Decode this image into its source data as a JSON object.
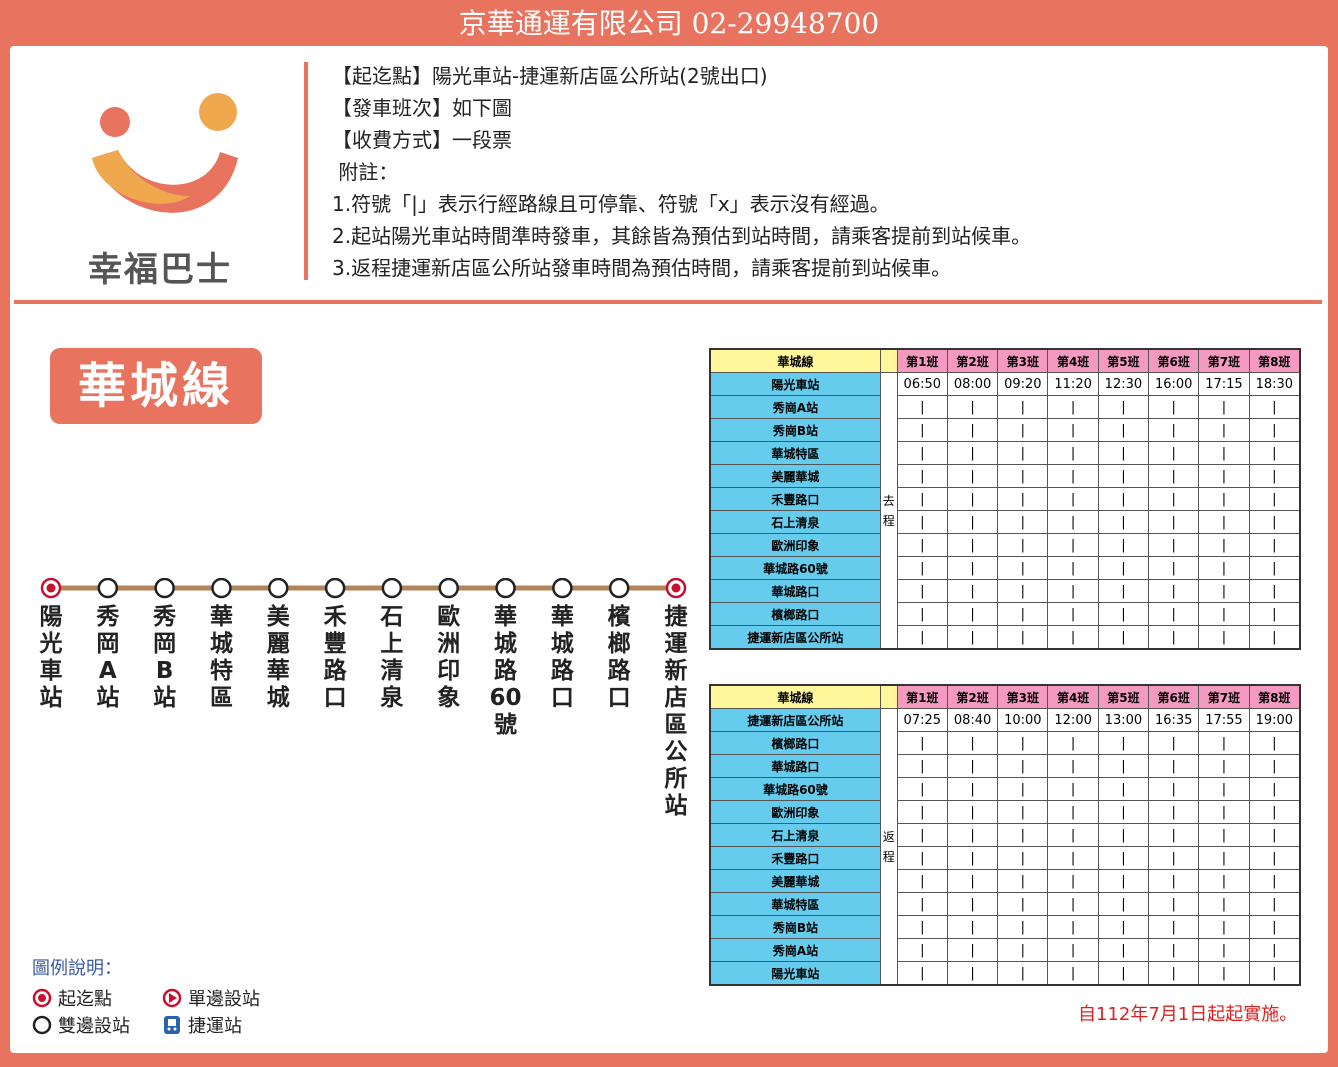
{
  "header": {
    "title": "京華通運有限公司 02-29948700"
  },
  "logo": {
    "text": "幸福巴士",
    "icon": "happy-bus-logo-icon"
  },
  "info_lines": [
    "【起迄點】陽光車站-捷運新店區公所站(2號出口)",
    "【發車班次】如下圖",
    "【收費方式】一段票",
    " 附註：",
    "1.符號「|」表示行經路線且可停靠、符號「x」表示沒有經過。",
    "2.起站陽光車站時間準時發車，其餘皆為預估到站時間，請乘客提前到站候車。",
    "3.返程捷運新店區公所站發車時間為預估時間，請乘客提前到站候車。"
  ],
  "route_name": "華城線",
  "stations": [
    {
      "label": "陽光車站",
      "type": "terminal"
    },
    {
      "label": "秀岡A站",
      "type": "both"
    },
    {
      "label": "秀岡B站",
      "type": "both"
    },
    {
      "label": "華城特區",
      "type": "both"
    },
    {
      "label": "美麗華城",
      "type": "both"
    },
    {
      "label": "禾豐路口",
      "type": "both"
    },
    {
      "label": "石上清泉",
      "type": "both"
    },
    {
      "label": "歐洲印象",
      "type": "both"
    },
    {
      "label": "華城路60號",
      "type": "both"
    },
    {
      "label": "華城路口",
      "type": "both"
    },
    {
      "label": "檳榔路口",
      "type": "both"
    },
    {
      "label": "捷運新店區公所站",
      "type": "terminal"
    }
  ],
  "legend": {
    "title": "圖例說明：",
    "terminal": "起迄點",
    "one_side": "單邊設站",
    "both_sides": "雙邊設站",
    "mrt": "捷運站"
  },
  "outbound": {
    "route": "華城線",
    "direction": "去程",
    "runs": [
      "第1班",
      "第2班",
      "第3班",
      "第4班",
      "第5班",
      "第6班",
      "第7班",
      "第8班"
    ],
    "stops": [
      "陽光車站",
      "秀崗A站",
      "秀崗B站",
      "華城特區",
      "美麗華城",
      "禾豐路口",
      "石上清泉",
      "歐洲印象",
      "華城路60號",
      "華城路口",
      "檳榔路口",
      "捷運新店區公所站"
    ],
    "first_times": [
      "06:50",
      "08:00",
      "09:20",
      "11:20",
      "12:30",
      "16:00",
      "17:15",
      "18:30"
    ],
    "pass_mark": "|"
  },
  "inbound": {
    "route": "華城線",
    "direction": "返程",
    "runs": [
      "第1班",
      "第2班",
      "第3班",
      "第4班",
      "第5班",
      "第6班",
      "第7班",
      "第8班"
    ],
    "stops": [
      "捷運新店區公所站",
      "檳榔路口",
      "華城路口",
      "華城路60號",
      "歐洲印象",
      "石上清泉",
      "禾豐路口",
      "美麗華城",
      "華城特區",
      "秀崗B站",
      "秀崗A站",
      "陽光車站"
    ],
    "first_times": [
      "07:25",
      "08:40",
      "10:00",
      "12:00",
      "13:00",
      "16:35",
      "17:55",
      "19:00"
    ],
    "pass_mark": "|"
  },
  "effective_date": "自112年7月1日起起實施。",
  "colors": {
    "frame": "#e8735e",
    "stop_cell": "#66ccee",
    "run_header": "#f49ac1",
    "route_header": "#fff799",
    "route_line": "#b5835a"
  }
}
